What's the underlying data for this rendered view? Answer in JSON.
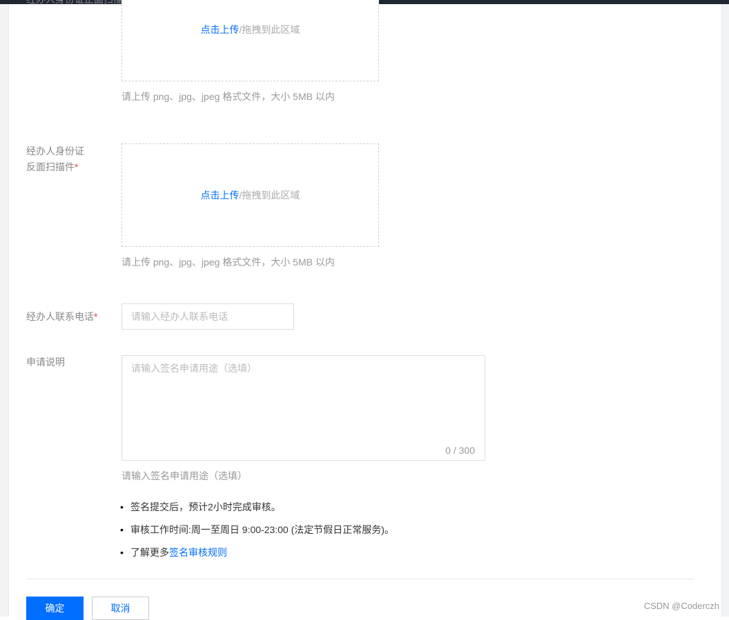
{
  "upload_front": {
    "label": "经办人身份证正面扫描件",
    "link": "点击上传",
    "rest": "/拖拽到此区域",
    "hint": "请上传 png、jpg、jpeg 格式文件，大小 5MB 以内"
  },
  "upload_back": {
    "label_line1": "经办人身份证",
    "label_line2": "反面扫描件",
    "required_mark": "*",
    "link": "点击上传",
    "rest": "/拖拽到此区域",
    "hint": "请上传 png、jpg、jpeg 格式文件，大小 5MB 以内"
  },
  "phone": {
    "label": "经办人联系电话",
    "required_mark": "*",
    "placeholder": "请输入经办人联系电话",
    "value": ""
  },
  "description": {
    "label": "申请说明",
    "placeholder": "请输入签名申请用途（选填）",
    "counter": "0 / 300",
    "hint": "请输入签名申请用途（选填）"
  },
  "notes": {
    "item1": "签名提交后，预计2小时完成审核。",
    "item2": "审核工作时间:周一至周日 9:00-23:00 (法定节假日正常服务)。",
    "item3_prefix": "了解更多",
    "item3_link": "签名审核规则",
    "bullet": "•"
  },
  "actions": {
    "confirm": "确定",
    "cancel": "取消"
  },
  "watermark": "CSDN @Coderczh",
  "colors": {
    "accent": "#006eff",
    "required": "#e54545"
  }
}
